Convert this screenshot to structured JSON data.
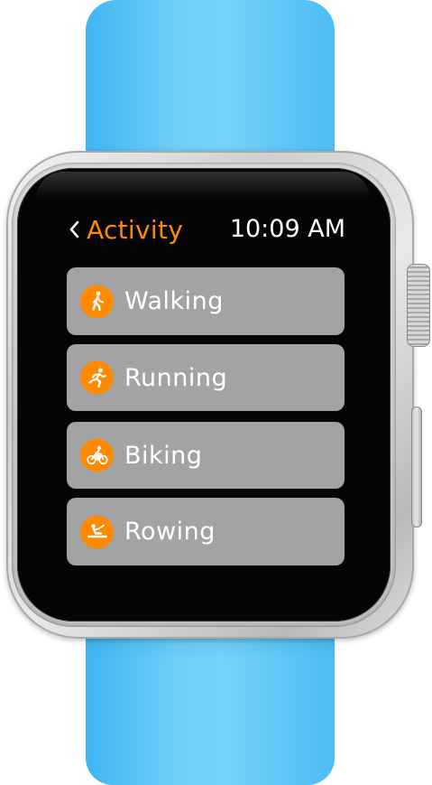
{
  "header": {
    "back_label": "Activity",
    "time": "10:09 AM"
  },
  "activities": [
    {
      "label": "Walking",
      "icon": "walking-icon"
    },
    {
      "label": "Running",
      "icon": "running-icon"
    },
    {
      "label": "Biking",
      "icon": "biking-icon"
    },
    {
      "label": "Rowing",
      "icon": "rowing-icon"
    }
  ],
  "colors": {
    "accent": "#ff8a00",
    "band": "#5fc8f8",
    "row_background": "#a3a3a3",
    "screen_background": "#050505"
  }
}
